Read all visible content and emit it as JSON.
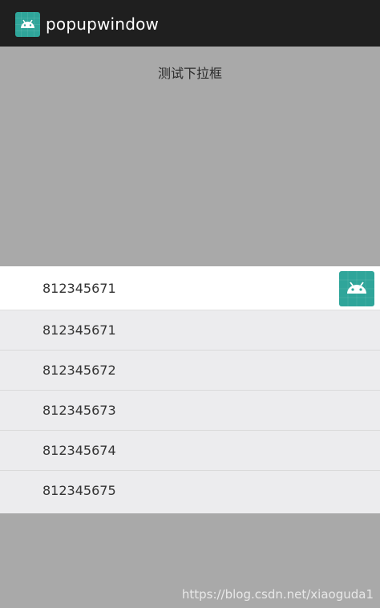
{
  "app": {
    "title": "popupwindow",
    "icon": "android-icon"
  },
  "main": {
    "prompt_text": "测试下拉框"
  },
  "selector": {
    "selected_value": "812345671",
    "dropdown_icon": "android-icon"
  },
  "popup": {
    "items": [
      {
        "label": "812345671"
      },
      {
        "label": "812345672"
      },
      {
        "label": "812345673"
      },
      {
        "label": "812345674"
      },
      {
        "label": "812345675"
      }
    ]
  },
  "watermark": {
    "text": "https://blog.csdn.net/xiaoguda1"
  },
  "colors": {
    "toolbar": "#1F1F1F",
    "background": "#A9A9A9",
    "accent": "#2FA59A",
    "list_background": "#ECECEE"
  }
}
